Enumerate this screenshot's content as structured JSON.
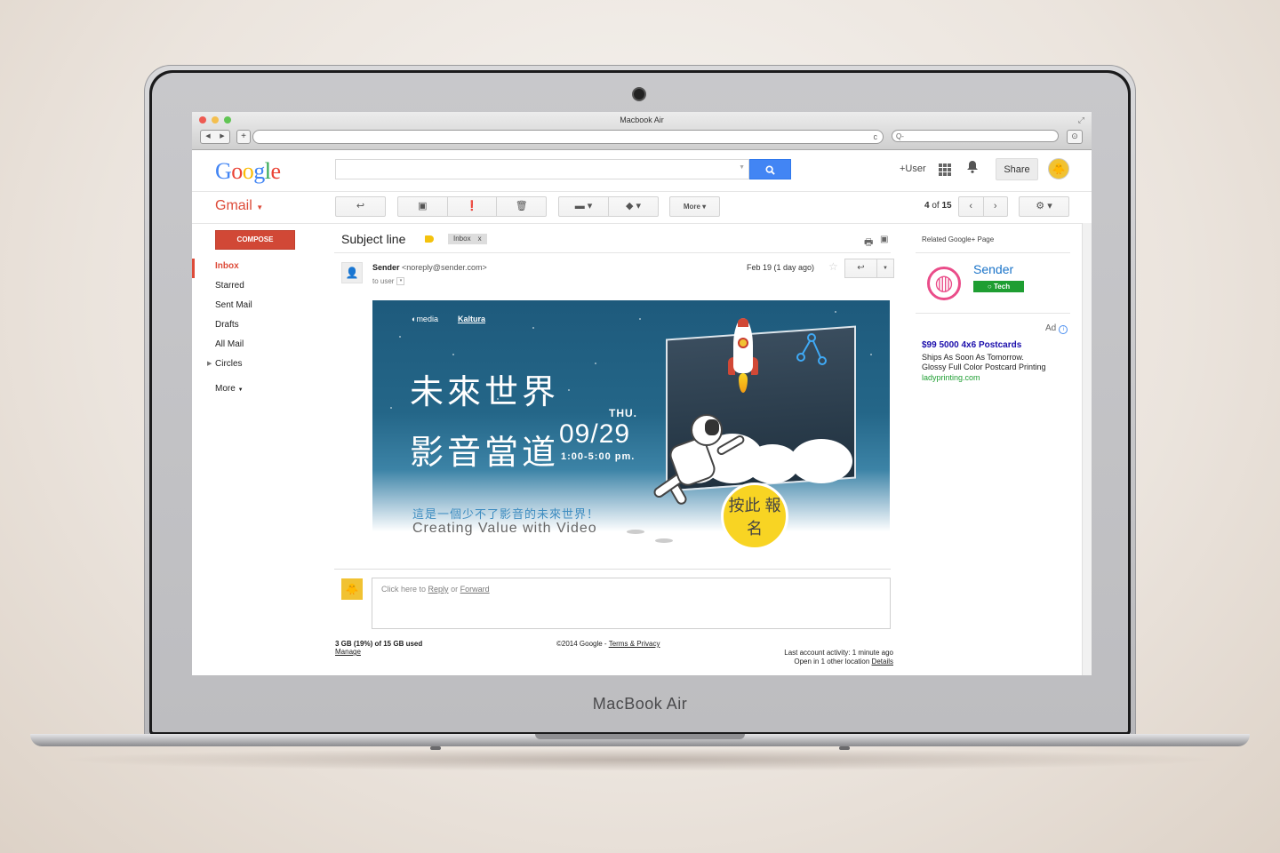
{
  "device": {
    "label": "MacBook Air"
  },
  "browser": {
    "window_title": "Macbook Air",
    "back": "◀",
    "forward": "▶",
    "new_tab": "+",
    "reload": "c",
    "search_icon": "Q-"
  },
  "google": {
    "logo": [
      "G",
      "o",
      "o",
      "g",
      "l",
      "e"
    ],
    "logo_colors": [
      "#4285f4",
      "#ea4335",
      "#fbbc05",
      "#4285f4",
      "#34a853",
      "#ea4335"
    ],
    "search_placeholder": "",
    "plus_user": "+User",
    "share": "Share"
  },
  "gmail": {
    "title": "Gmail",
    "compose": "COMPOSE",
    "nav": [
      {
        "label": "Inbox",
        "active": true
      },
      {
        "label": "Starred"
      },
      {
        "label": "Sent Mail"
      },
      {
        "label": "Drafts"
      },
      {
        "label": "All Mail"
      },
      {
        "label": "Circles"
      }
    ],
    "more": "More",
    "toolbar": {
      "more": "More"
    },
    "pager": {
      "current": "4",
      "of": "of",
      "total": "15"
    }
  },
  "message": {
    "subject": "Subject line",
    "label": "Inbox",
    "label_close": "x",
    "sender_name": "Sender",
    "sender_email": "<noreply@sender.com>",
    "to": "to user",
    "date": "Feb 19 (1 day ago)",
    "banner": {
      "logo1": "media",
      "logo2": "Kaltura",
      "title1": "未來世界",
      "title2": "影音當道",
      "day": "THU.",
      "date": "09/29",
      "time": "1:00-5:00 pm.",
      "tagline_zh": "這是一個少不了影音的未來世界！",
      "tagline_en": "Creating Value with Video",
      "signup": "按此 報名"
    }
  },
  "reply": {
    "prefix": "Click here to",
    "reply": "Reply",
    "or": "or",
    "forward": "Forward"
  },
  "footer": {
    "storage": "3 GB (19%) of 15 GB used",
    "manage": "Manage",
    "copyright": "©2014 Google -",
    "terms": "Terms & Privacy",
    "activity": "Last account activity: 1 minute ago",
    "location": "Open in 1 other location",
    "details": "Details"
  },
  "right_panel": {
    "title": "Related Google+ Page",
    "page_name": "Sender",
    "badge": "Tech",
    "ad_label": "Ad",
    "ad_title": "$99 5000 4x6 Postcards",
    "ad_line1": "Ships As Soon As Tomorrow.",
    "ad_line2": "Glossy Full Color Postcard Printing",
    "ad_url": "ladyprinting.com"
  }
}
